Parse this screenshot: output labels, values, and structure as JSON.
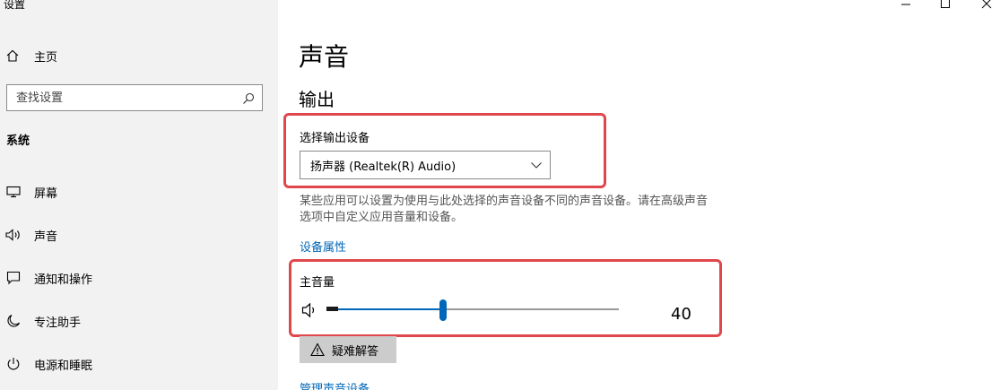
{
  "window": {
    "title": "设置"
  },
  "sidebar": {
    "home_label": "主页",
    "search_placeholder": "查找设置",
    "section_label": "系统",
    "items": [
      {
        "label": "屏幕",
        "icon": "monitor-icon"
      },
      {
        "label": "声音",
        "icon": "speaker-icon"
      },
      {
        "label": "通知和操作",
        "icon": "notification-icon"
      },
      {
        "label": "专注助手",
        "icon": "moon-icon"
      },
      {
        "label": "电源和睡眠",
        "icon": "power-icon"
      }
    ]
  },
  "main": {
    "page_title": "声音",
    "output_heading": "输出",
    "device_label": "选择输出设备",
    "device_value": "扬声器 (Realtek(R) Audio)",
    "description": "某些应用可以设置为使用与此处选择的声音设备不同的声音设备。请在高级声音选项中自定义应用音量和设备。",
    "device_properties_link": "设备属性",
    "volume_label": "主音量",
    "volume_value": "40",
    "volume_level": 40,
    "troubleshoot_label": "疑难解答",
    "manage_devices_link": "管理声音设备"
  },
  "colors": {
    "accent": "#0067b8",
    "highlight_box": "#e0474c",
    "sidebar_bg": "#f2f2f2"
  }
}
